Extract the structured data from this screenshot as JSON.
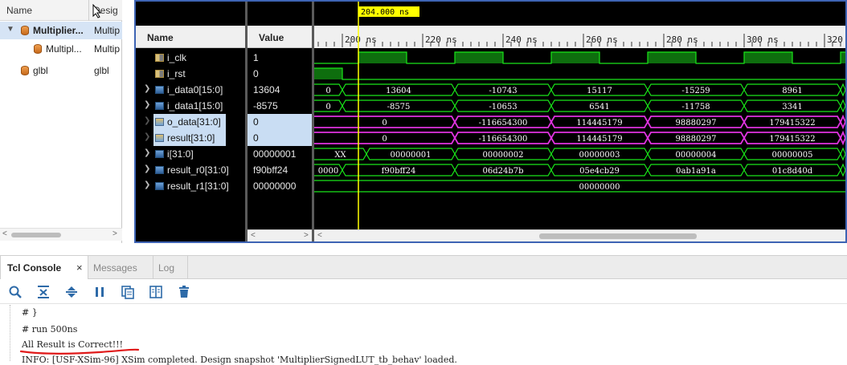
{
  "scope": {
    "col_name": "Name",
    "col_design": "Desig",
    "rows": [
      {
        "name": "Multiplier...",
        "design": "Multip"
      },
      {
        "name": "Multipl...",
        "design": "Multip"
      },
      {
        "name": "glbl",
        "design": "glbl"
      }
    ]
  },
  "wave": {
    "col_name": "Name",
    "col_value": "Value",
    "cursor_label": "204.000 ns",
    "time_ticks": [
      "200 ns",
      "220 ns",
      "240 ns",
      "260 ns",
      "280 ns",
      "300 ns",
      "320 n"
    ],
    "signals": [
      {
        "name": "i_clk",
        "value": "1",
        "icon": "bit-icon",
        "expandable": false
      },
      {
        "name": "i_rst",
        "value": "0",
        "icon": "bit-icon",
        "expandable": false
      },
      {
        "name": "i_data0[15:0]",
        "value": "13604",
        "icon": "bus-icon",
        "expandable": true
      },
      {
        "name": "i_data1[15:0]",
        "value": "-8575",
        "icon": "bus-icon",
        "expandable": true
      },
      {
        "name": "o_data[31:0]",
        "value": "0",
        "icon": "output-bus-icon",
        "expandable": true
      },
      {
        "name": "result[31:0]",
        "value": "0",
        "icon": "output-bus-icon",
        "expandable": true
      },
      {
        "name": "i[31:0]",
        "value": "00000001",
        "icon": "bus-icon",
        "expandable": true
      },
      {
        "name": "result_r0[31:0]",
        "value": "f90bff24",
        "icon": "bus-icon",
        "expandable": true
      },
      {
        "name": "result_r1[31:0]",
        "value": "00000000",
        "icon": "bus-icon",
        "expandable": true
      }
    ],
    "bus_segments": [
      [
        "0",
        "13604",
        "-10743",
        "15117",
        "-15259",
        "8961",
        ""
      ],
      [
        "0",
        "-8575",
        "-10653",
        "6541",
        "-11758",
        "3341",
        ""
      ],
      [
        "",
        "0",
        "-116654300",
        "114445179",
        "98880297",
        "179415322",
        ""
      ],
      [
        "",
        "0",
        "-116654300",
        "114445179",
        "98880297",
        "179415322",
        ""
      ],
      [
        "XX",
        "00000001",
        "00000002",
        "00000003",
        "00000004",
        "00000005",
        ""
      ],
      [
        "0000",
        "f90bff24",
        "06d24b7b",
        "05e4cb29",
        "0ab1a91a",
        "01c8d40d",
        ""
      ],
      [
        "00000000"
      ]
    ],
    "colors": {
      "bus": "#19e619",
      "highlight_bus": "#e033e0",
      "clock_fill": "#0e6e0e",
      "cursor": "#ffff00"
    }
  },
  "console": {
    "tabs": [
      "Tcl Console",
      "Messages",
      "Log"
    ],
    "close_glyph": "×",
    "lines": [
      "# }",
      "# run 500ns",
      "All Result is Correct!!!",
      "INFO: [USF-XSim-96] XSim completed. Design snapshot 'MultiplierSignedLUT_tb_behav' loaded."
    ]
  }
}
